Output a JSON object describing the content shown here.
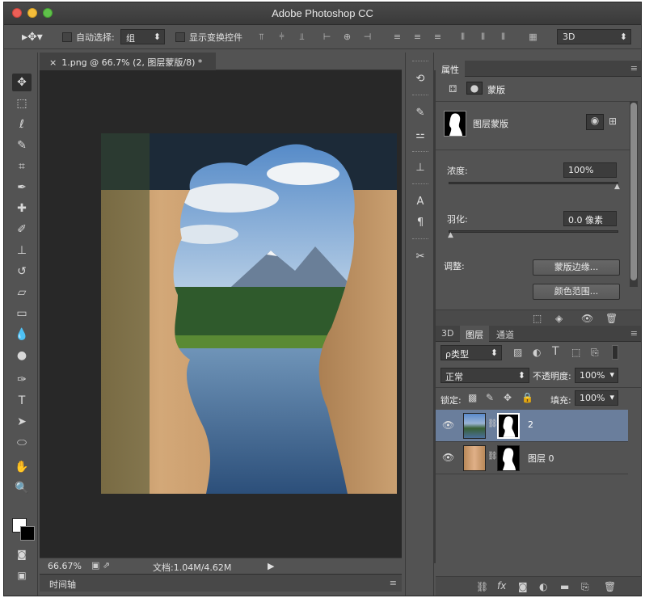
{
  "app": {
    "title": "Adobe Photoshop CC"
  },
  "options_bar": {
    "auto_select_label": "自动选择:",
    "auto_select_value": "组",
    "show_transform_label": "显示变换控件",
    "mode_3d": "3D"
  },
  "document": {
    "tab_label": "1.png @ 66.7% (2, 图层蒙版/8) *",
    "zoom": "66.67%",
    "doc_size": "文档:1.04M/4.62M"
  },
  "timeline": {
    "label": "时间轴"
  },
  "properties": {
    "tab": "属性",
    "type_label": "蒙版",
    "mask_title": "图层蒙版",
    "density_label": "浓度:",
    "density_value": "100%",
    "density_fraction": 1.0,
    "feather_label": "羽化:",
    "feather_value": "0.0 像素",
    "feather_fraction": 0.0,
    "adjust_label": "调整:",
    "mask_edge_button": "蒙版边缘...",
    "color_range_button": "颜色范围..."
  },
  "layers_panel": {
    "tabs": [
      "3D",
      "图层",
      "通道"
    ],
    "filter_kind": "ρ类型",
    "blend_mode": "正常",
    "opacity_label": "不透明度:",
    "opacity_value": "100%",
    "lock_label": "锁定:",
    "fill_label": "填充:",
    "fill_value": "100%",
    "layers": [
      {
        "name": "2",
        "selected": true
      },
      {
        "name": "图层 0",
        "selected": false
      }
    ]
  },
  "colors": {
    "selected_layer": "#6a7e9c",
    "panel": "#535353",
    "canvas_bg": "#282828"
  }
}
